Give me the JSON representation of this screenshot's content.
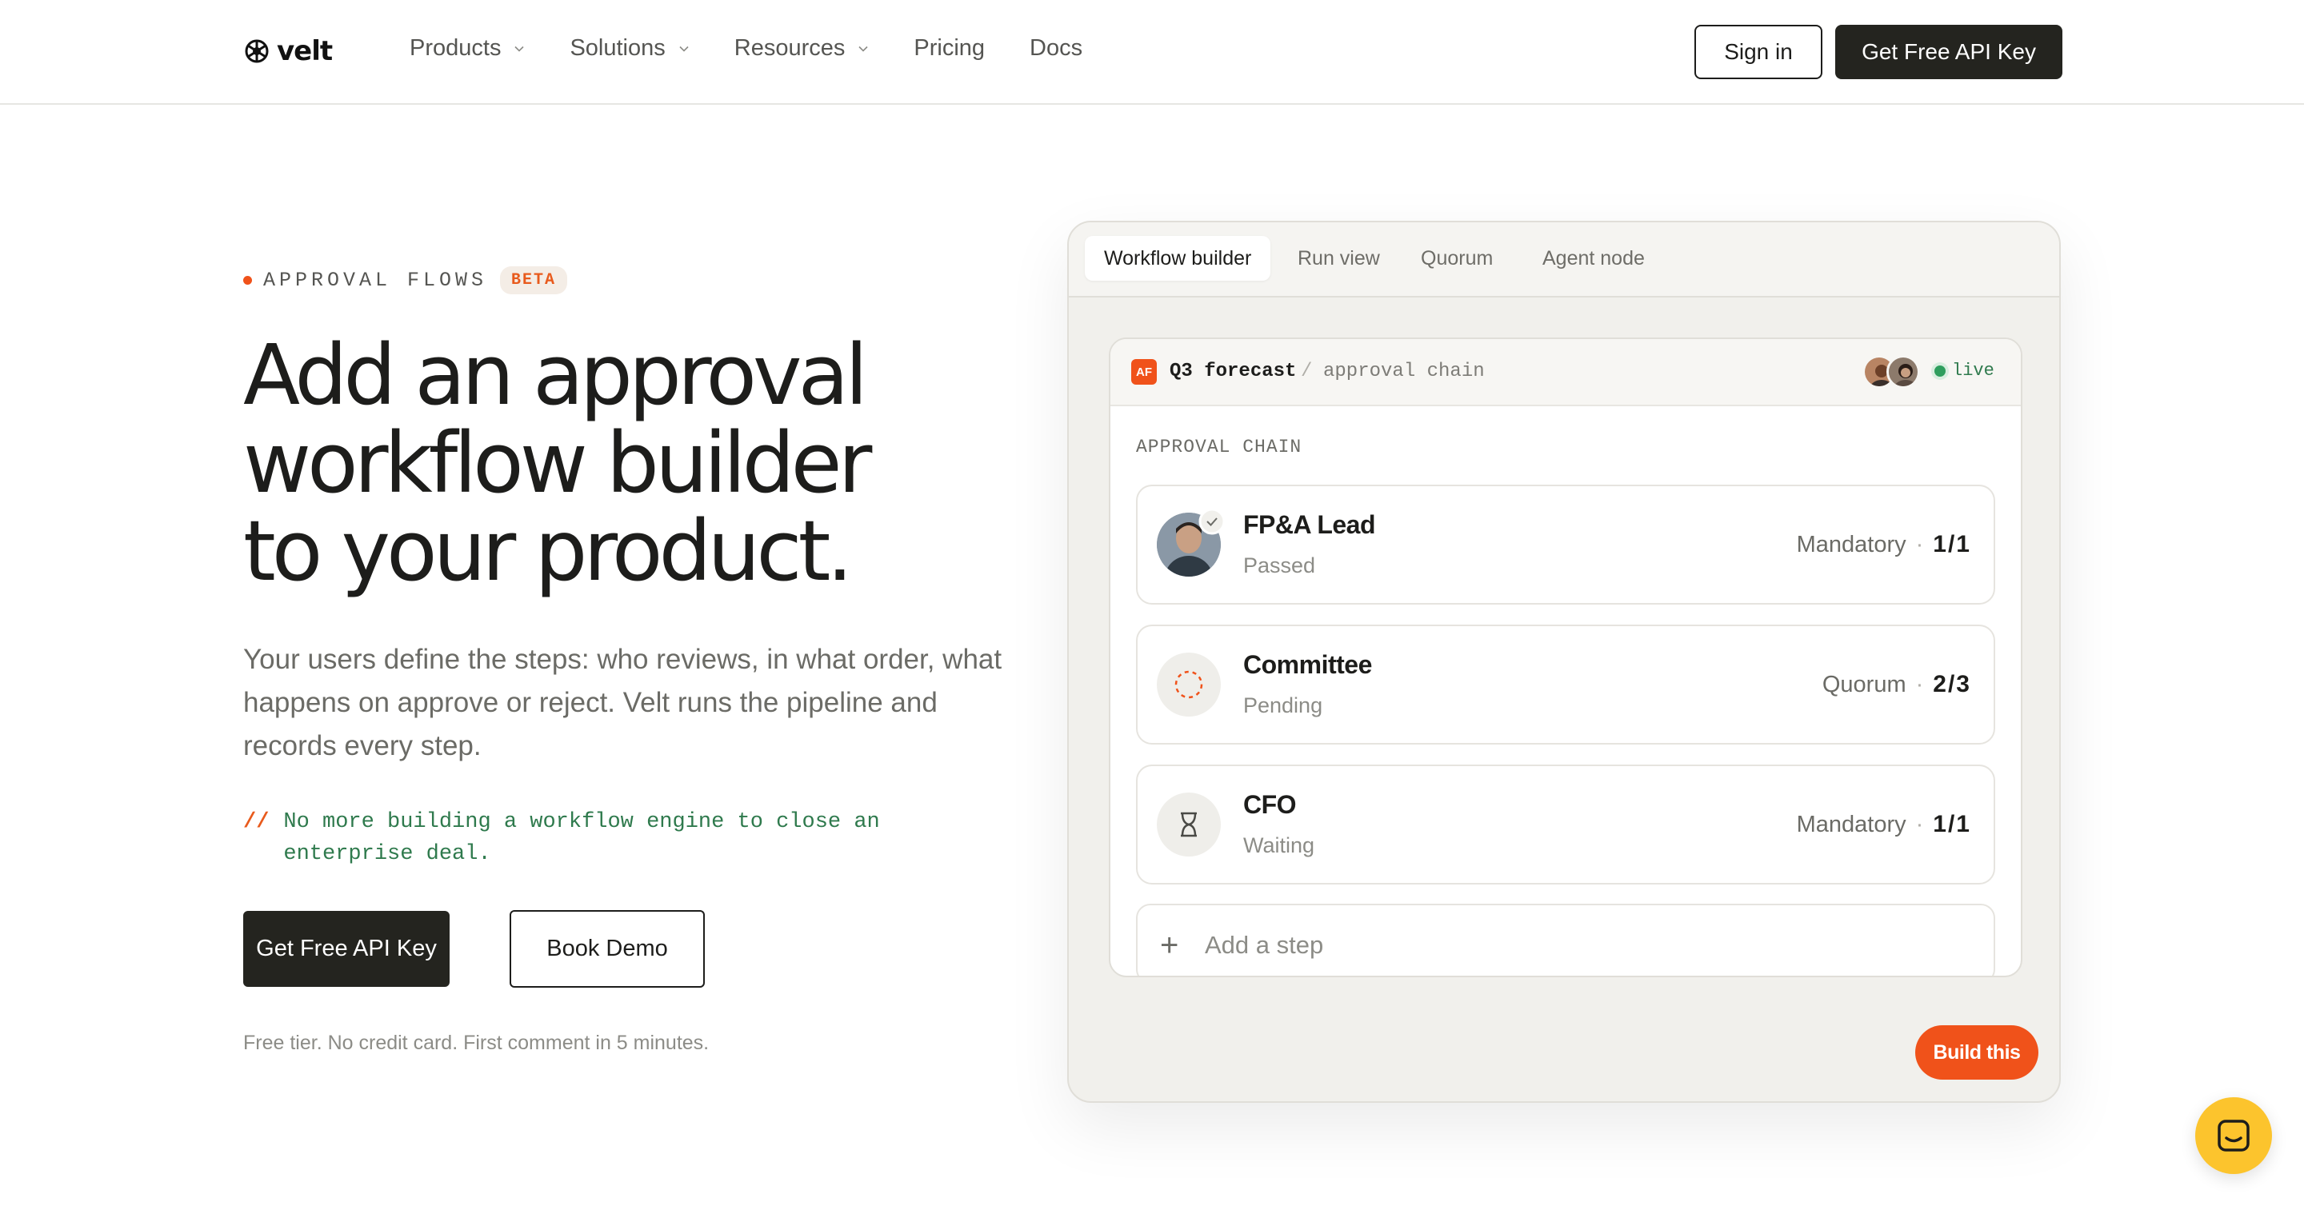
{
  "nav": {
    "logo_text": "velt",
    "items": [
      {
        "label": "Products",
        "has_dropdown": true
      },
      {
        "label": "Solutions",
        "has_dropdown": true
      },
      {
        "label": "Resources",
        "has_dropdown": true
      },
      {
        "label": "Pricing",
        "has_dropdown": false
      },
      {
        "label": "Docs",
        "has_dropdown": false
      }
    ],
    "sign_in": "Sign in",
    "cta": "Get Free API Key"
  },
  "hero": {
    "eyebrow": "APPROVAL FLOWS",
    "badge": "BETA",
    "headline": [
      "Add an approval",
      "workflow builder",
      "to your product."
    ],
    "subtext": "Your users define the steps: who reviews, in what order, what happens on approve or reject. Velt runs the pipeline and records every step.",
    "note_prefix": "//",
    "note": "No more building a workflow engine to close an enterprise deal.",
    "primary_cta": "Get Free API Key",
    "secondary_cta": "Book Demo",
    "fine_print": "Free tier. No credit card. First comment in 5 minutes."
  },
  "demo": {
    "tabs": [
      "Workflow builder",
      "Run view",
      "Quorum",
      "Agent node"
    ],
    "active_tab": 0,
    "doc_badge": "AF",
    "doc_title": "Q3 forecast",
    "doc_sep": "/",
    "doc_sub": "approval chain",
    "live_label": "live",
    "chain_label": "APPROVAL CHAIN",
    "steps": [
      {
        "name": "FP&A Lead",
        "state": "Passed",
        "rule": "Mandatory",
        "count": "1/1",
        "icon": "avatar-check"
      },
      {
        "name": "Committee",
        "state": "Pending",
        "rule": "Quorum",
        "count": "2/3",
        "icon": "dashed-circle-icon"
      },
      {
        "name": "CFO",
        "state": "Waiting",
        "rule": "Mandatory",
        "count": "1/1",
        "icon": "hourglass-icon"
      }
    ],
    "add_step": "Add a step",
    "build_button": "Build this"
  },
  "colors": {
    "accent": "#f0521a",
    "dark": "#24241f",
    "live_green": "#2f9e5d",
    "chat_yellow": "#fcc42d"
  }
}
